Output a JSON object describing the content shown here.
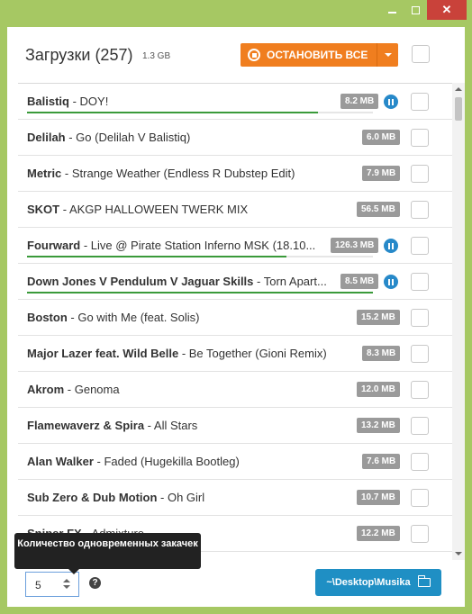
{
  "window": {
    "minimize_label": "",
    "maximize_label": "",
    "close_label": "✕"
  },
  "header": {
    "title": "Загрузки (257)",
    "total_size": "1.3 GB",
    "stop_all_label": "ОСТАНОВИТЬ ВСЕ"
  },
  "downloads": [
    {
      "artist": "Balistiq",
      "title": " - DOY!",
      "size": "8.2 MB",
      "paused": true,
      "progress": 0.84
    },
    {
      "artist": "Delilah",
      "title": " - Go (Delilah V Balistiq)",
      "size": "6.0 MB",
      "paused": false,
      "progress": null
    },
    {
      "artist": "Metric",
      "title": " - Strange Weather (Endless R Dubstep Edit)",
      "size": "7.9 MB",
      "paused": false,
      "progress": null
    },
    {
      "artist": "SKOT",
      "title": " - AKGP HALLOWEEN TWERK MIX",
      "size": "56.5 MB",
      "paused": false,
      "progress": null
    },
    {
      "artist": "Fourward",
      "title": " - Live @ Pirate Station Inferno MSK (18.10...",
      "size": "126.3 MB",
      "paused": true,
      "progress": 0.75
    },
    {
      "artist": "Down Jones V Pendulum V Jaguar Skills",
      "title": " - Torn Apart...",
      "size": "8.5 MB",
      "paused": true,
      "progress": 1.0
    },
    {
      "artist": "Boston",
      "title": " - Go with Me (feat. Solis)",
      "size": "15.2 MB",
      "paused": false,
      "progress": null
    },
    {
      "artist": "Major Lazer feat. Wild Belle",
      "title": " - Be Together (Gioni Remix)",
      "size": "8.3 MB",
      "paused": false,
      "progress": null
    },
    {
      "artist": "Akrom",
      "title": " - Genoma",
      "size": "12.0 MB",
      "paused": false,
      "progress": null
    },
    {
      "artist": "Flamewaverz & Spira",
      "title": " - All Stars",
      "size": "13.2 MB",
      "paused": false,
      "progress": null
    },
    {
      "artist": "Alan Walker",
      "title": " - Faded (Hugekilla Bootleg)",
      "size": "7.6 MB",
      "paused": false,
      "progress": null
    },
    {
      "artist": "Sub Zero & Dub Motion",
      "title": " - Oh Girl",
      "size": "10.7 MB",
      "paused": false,
      "progress": null
    },
    {
      "artist": "Sniper FX",
      "title": " - Admixture",
      "size": "12.2 MB",
      "paused": false,
      "progress": null
    }
  ],
  "footer": {
    "tooltip": "Количество одновременных закачек",
    "concurrent_value": "5",
    "help_icon": "?",
    "folder_label": "~\\Desktop\\Musika"
  },
  "colors": {
    "accent_orange": "#f07e1f",
    "accent_blue": "#1f8fc4",
    "progress_green": "#3a9a3a",
    "window_frame": "#a6c863"
  }
}
